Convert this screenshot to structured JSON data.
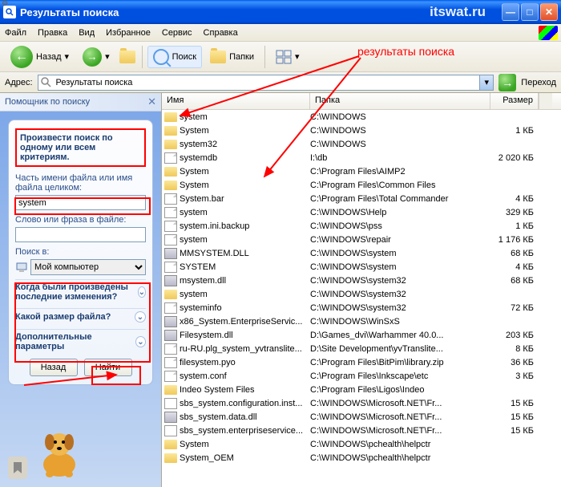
{
  "titlebar": {
    "title": "Результаты поиска",
    "site": "itswat.ru"
  },
  "menu": [
    "Файл",
    "Правка",
    "Вид",
    "Избранное",
    "Сервис",
    "Справка"
  ],
  "toolbar": {
    "back": "Назад",
    "search": "Поиск",
    "folders": "Папки"
  },
  "address": {
    "label": "Адрес:",
    "value": "Результаты поиска",
    "go": "Переход"
  },
  "sidebar": {
    "header": "Помощник по поиску",
    "criteria_header": "Произвести поиск по одному или всем критериям.",
    "filename_label": "Часть имени файла или имя файла целиком:",
    "filename_value": "system",
    "phrase_label": "Слово или фраза в файле:",
    "phrase_value": "",
    "lookin_label": "Поиск в:",
    "lookin_value": "Мой компьютер",
    "exp1": "Когда были произведены последние изменения?",
    "exp2": "Какой размер файла?",
    "exp3": "Дополнительные параметры",
    "btn_back": "Назад",
    "btn_find": "Найти"
  },
  "columns": {
    "name": "Имя",
    "path": "Папка",
    "size": "Размер"
  },
  "annotation": "результаты поиска",
  "results": [
    {
      "icon": "folder",
      "name": "system",
      "path": "C:\\WINDOWS",
      "size": ""
    },
    {
      "icon": "folder",
      "name": "System",
      "path": "C:\\WINDOWS",
      "size": "1 КБ"
    },
    {
      "icon": "folder",
      "name": "system32",
      "path": "C:\\WINDOWS",
      "size": ""
    },
    {
      "icon": "file",
      "name": "systemdb",
      "path": "I:\\db",
      "size": "2 020 КБ"
    },
    {
      "icon": "folder",
      "name": "System",
      "path": "C:\\Program Files\\AIMP2",
      "size": ""
    },
    {
      "icon": "folder",
      "name": "System",
      "path": "C:\\Program Files\\Common Files",
      "size": ""
    },
    {
      "icon": "file",
      "name": "System.bar",
      "path": "C:\\Program Files\\Total Commander",
      "size": "4 КБ"
    },
    {
      "icon": "file",
      "name": "system",
      "path": "C:\\WINDOWS\\Help",
      "size": "329 КБ"
    },
    {
      "icon": "file",
      "name": "system.ini.backup",
      "path": "C:\\WINDOWS\\pss",
      "size": "1 КБ"
    },
    {
      "icon": "file",
      "name": "system",
      "path": "C:\\WINDOWS\\repair",
      "size": "1 176 КБ"
    },
    {
      "icon": "dll",
      "name": "MMSYSTEM.DLL",
      "path": "C:\\WINDOWS\\system",
      "size": "68 КБ"
    },
    {
      "icon": "file",
      "name": "SYSTEM",
      "path": "C:\\WINDOWS\\system",
      "size": "4 КБ"
    },
    {
      "icon": "dll",
      "name": "msystem.dll",
      "path": "C:\\WINDOWS\\system32",
      "size": "68 КБ"
    },
    {
      "icon": "folder",
      "name": "system",
      "path": "C:\\WINDOWS\\system32",
      "size": ""
    },
    {
      "icon": "file",
      "name": "systeminfo",
      "path": "C:\\WINDOWS\\system32",
      "size": "72 КБ"
    },
    {
      "icon": "dll",
      "name": "x86_System.EnterpriseServic...",
      "path": "C:\\WINDOWS\\WinSxS",
      "size": ""
    },
    {
      "icon": "dll",
      "name": "Filesystem.dll",
      "path": "D:\\Games_dvi\\Warhammer 40.0...",
      "size": "203 КБ"
    },
    {
      "icon": "file",
      "name": "ru-RU.plg_system_yvtranslite...",
      "path": "D:\\Site Development\\yvTranslite...",
      "size": "8 КБ"
    },
    {
      "icon": "file",
      "name": "filesystem.pyo",
      "path": "C:\\Program Files\\BitPim\\library.zip",
      "size": "36 КБ"
    },
    {
      "icon": "file",
      "name": "system.conf",
      "path": "C:\\Program Files\\Inkscape\\etc",
      "size": "3 КБ"
    },
    {
      "icon": "folder",
      "name": "Indeo System Files",
      "path": "C:\\Program Files\\Ligos\\Indeo",
      "size": ""
    },
    {
      "icon": "config",
      "name": "sbs_system.configuration.inst...",
      "path": "C:\\WINDOWS\\Microsoft.NET\\Fr...",
      "size": "15 КБ"
    },
    {
      "icon": "dll",
      "name": "sbs_system.data.dll",
      "path": "C:\\WINDOWS\\Microsoft.NET\\Fr...",
      "size": "15 КБ"
    },
    {
      "icon": "config",
      "name": "sbs_system.enterpriseservice...",
      "path": "C:\\WINDOWS\\Microsoft.NET\\Fr...",
      "size": "15 КБ"
    },
    {
      "icon": "folder",
      "name": "System",
      "path": "C:\\WINDOWS\\pchealth\\helpctr",
      "size": ""
    },
    {
      "icon": "folder",
      "name": "System_OEM",
      "path": "C:\\WINDOWS\\pchealth\\helpctr",
      "size": ""
    }
  ]
}
